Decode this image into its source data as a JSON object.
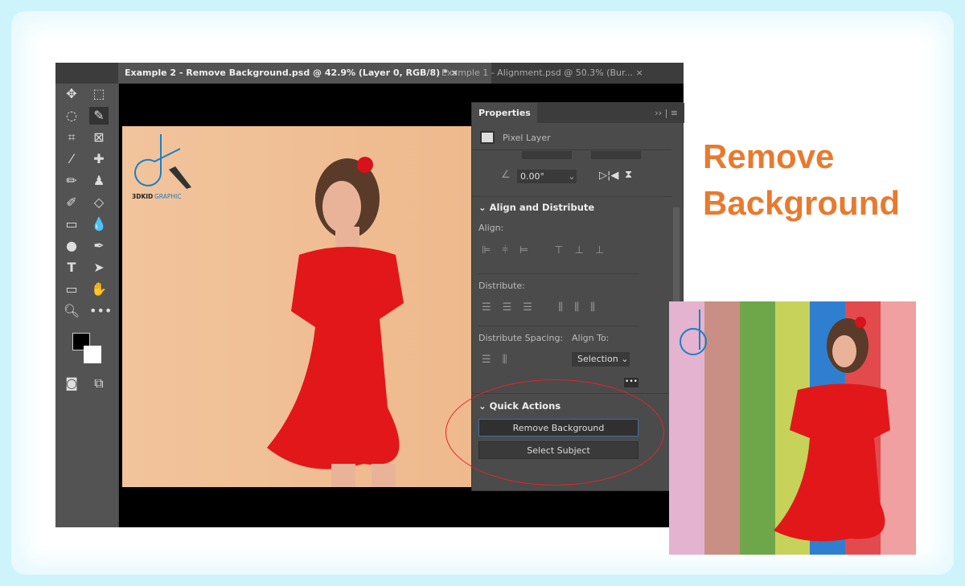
{
  "tabs": [
    {
      "label": "Example 2 - Remove Background.psd @ 42.9% (Layer 0, RGB/8) *",
      "close": "×"
    },
    {
      "label": "Example 1 - Alignment.psd @ 50.3% (Bur...",
      "close": "×"
    }
  ],
  "logo": {
    "text": "3DKID GRAPHIC"
  },
  "properties": {
    "tab": "Properties",
    "layer_type": "Pixel Layer",
    "angle": "0.00°",
    "align_section": "Align and Distribute",
    "align_label": "Align:",
    "distribute_label": "Distribute:",
    "spacing_label": "Distribute Spacing:",
    "align_to_label": "Align To:",
    "align_to_value": "Selection",
    "quick_actions": "Quick Actions",
    "remove_bg": "Remove Background",
    "select_subject": "Select Subject"
  },
  "headline": {
    "line1": "Remove",
    "line2": "Background"
  },
  "colors": {
    "accent": "#e87a2e",
    "highlight": "#e0262c"
  }
}
